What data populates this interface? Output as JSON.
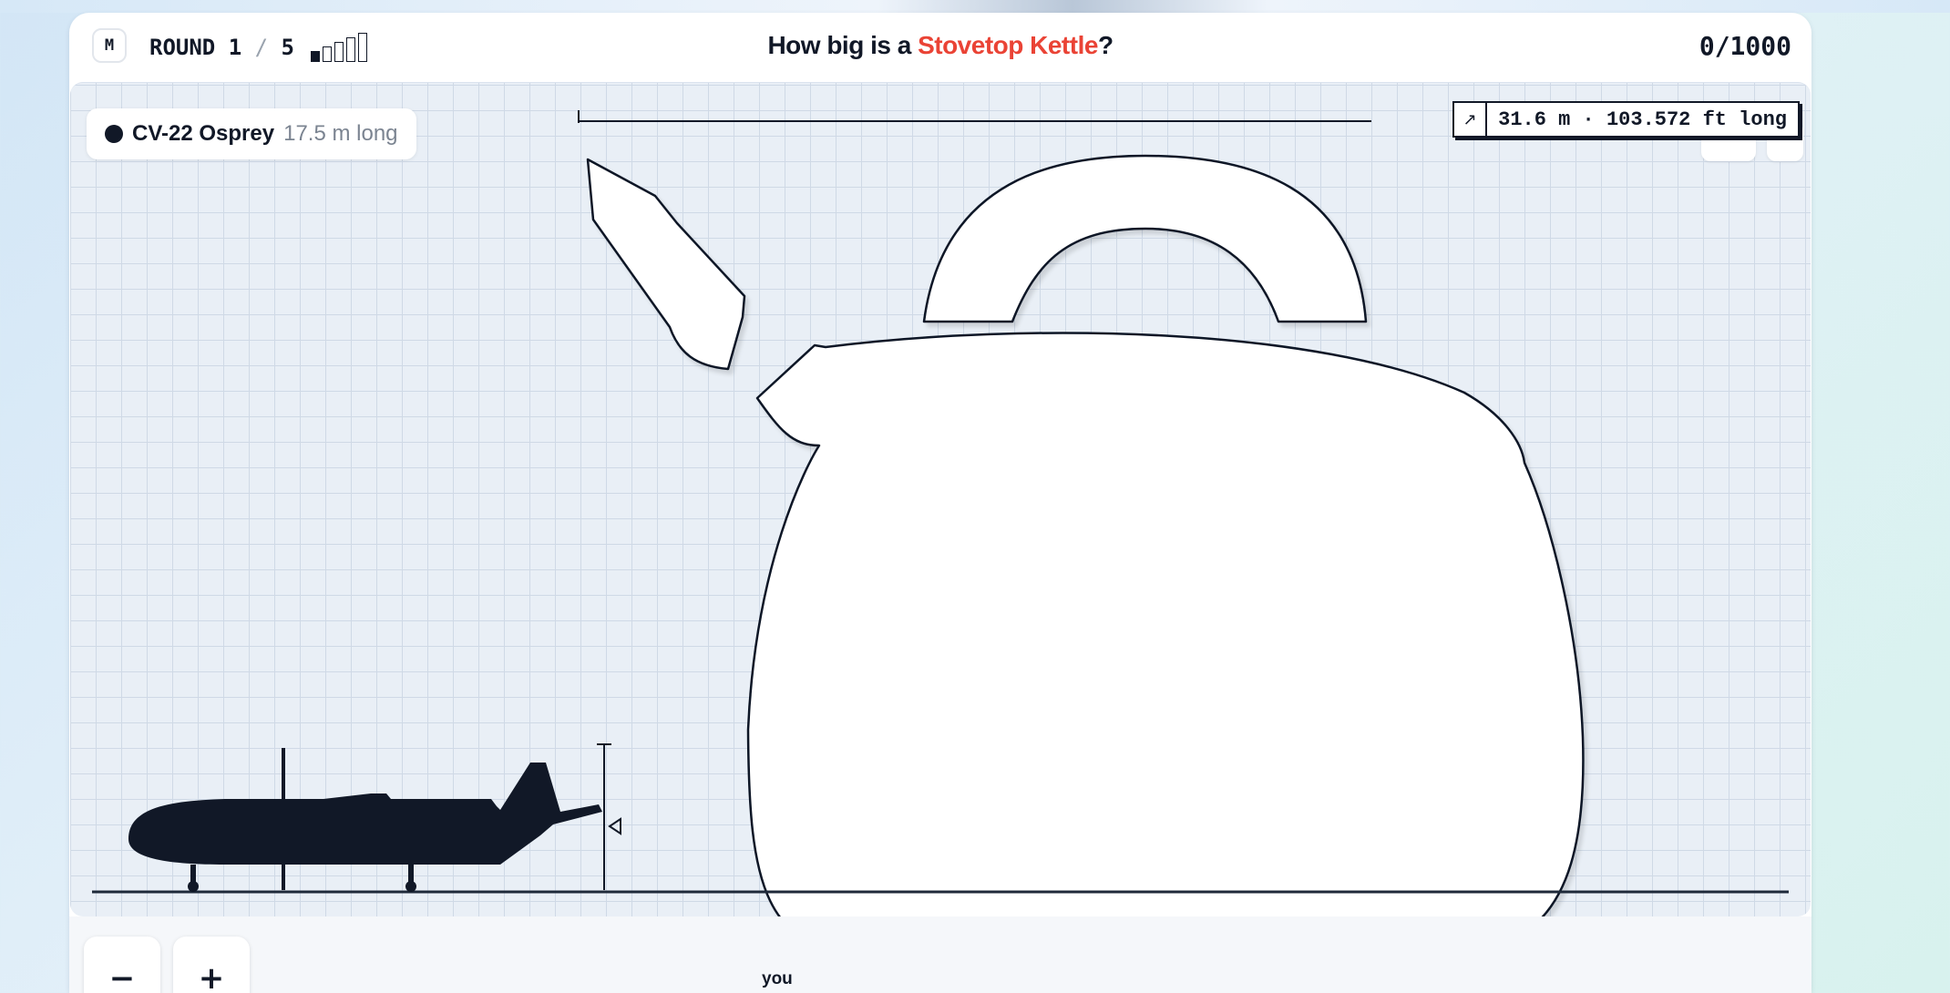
{
  "header": {
    "mode_button": "M",
    "round_label": "ROUND",
    "round_current": "1",
    "round_separator": "/",
    "round_total": "5",
    "round_progress": {
      "completed": 1,
      "total": 5
    },
    "question_prefix": "How big is a ",
    "question_subject": "Stovetop Kettle",
    "question_suffix": "?",
    "score": "0/1000"
  },
  "reference": {
    "name": "CV-22 Osprey",
    "size": "17.5 m long"
  },
  "measurement": {
    "icon": "arrow-up-right-icon",
    "label": "31.6 m · 103.572 ft long"
  },
  "footer": {
    "zoom_out_label": "−",
    "zoom_in_label": "+",
    "you_label": "you"
  },
  "colors": {
    "accent": "#ea4335",
    "ink": "#111827",
    "grid": "#cfd9e6",
    "canvas_bg": "#e9eff6"
  }
}
